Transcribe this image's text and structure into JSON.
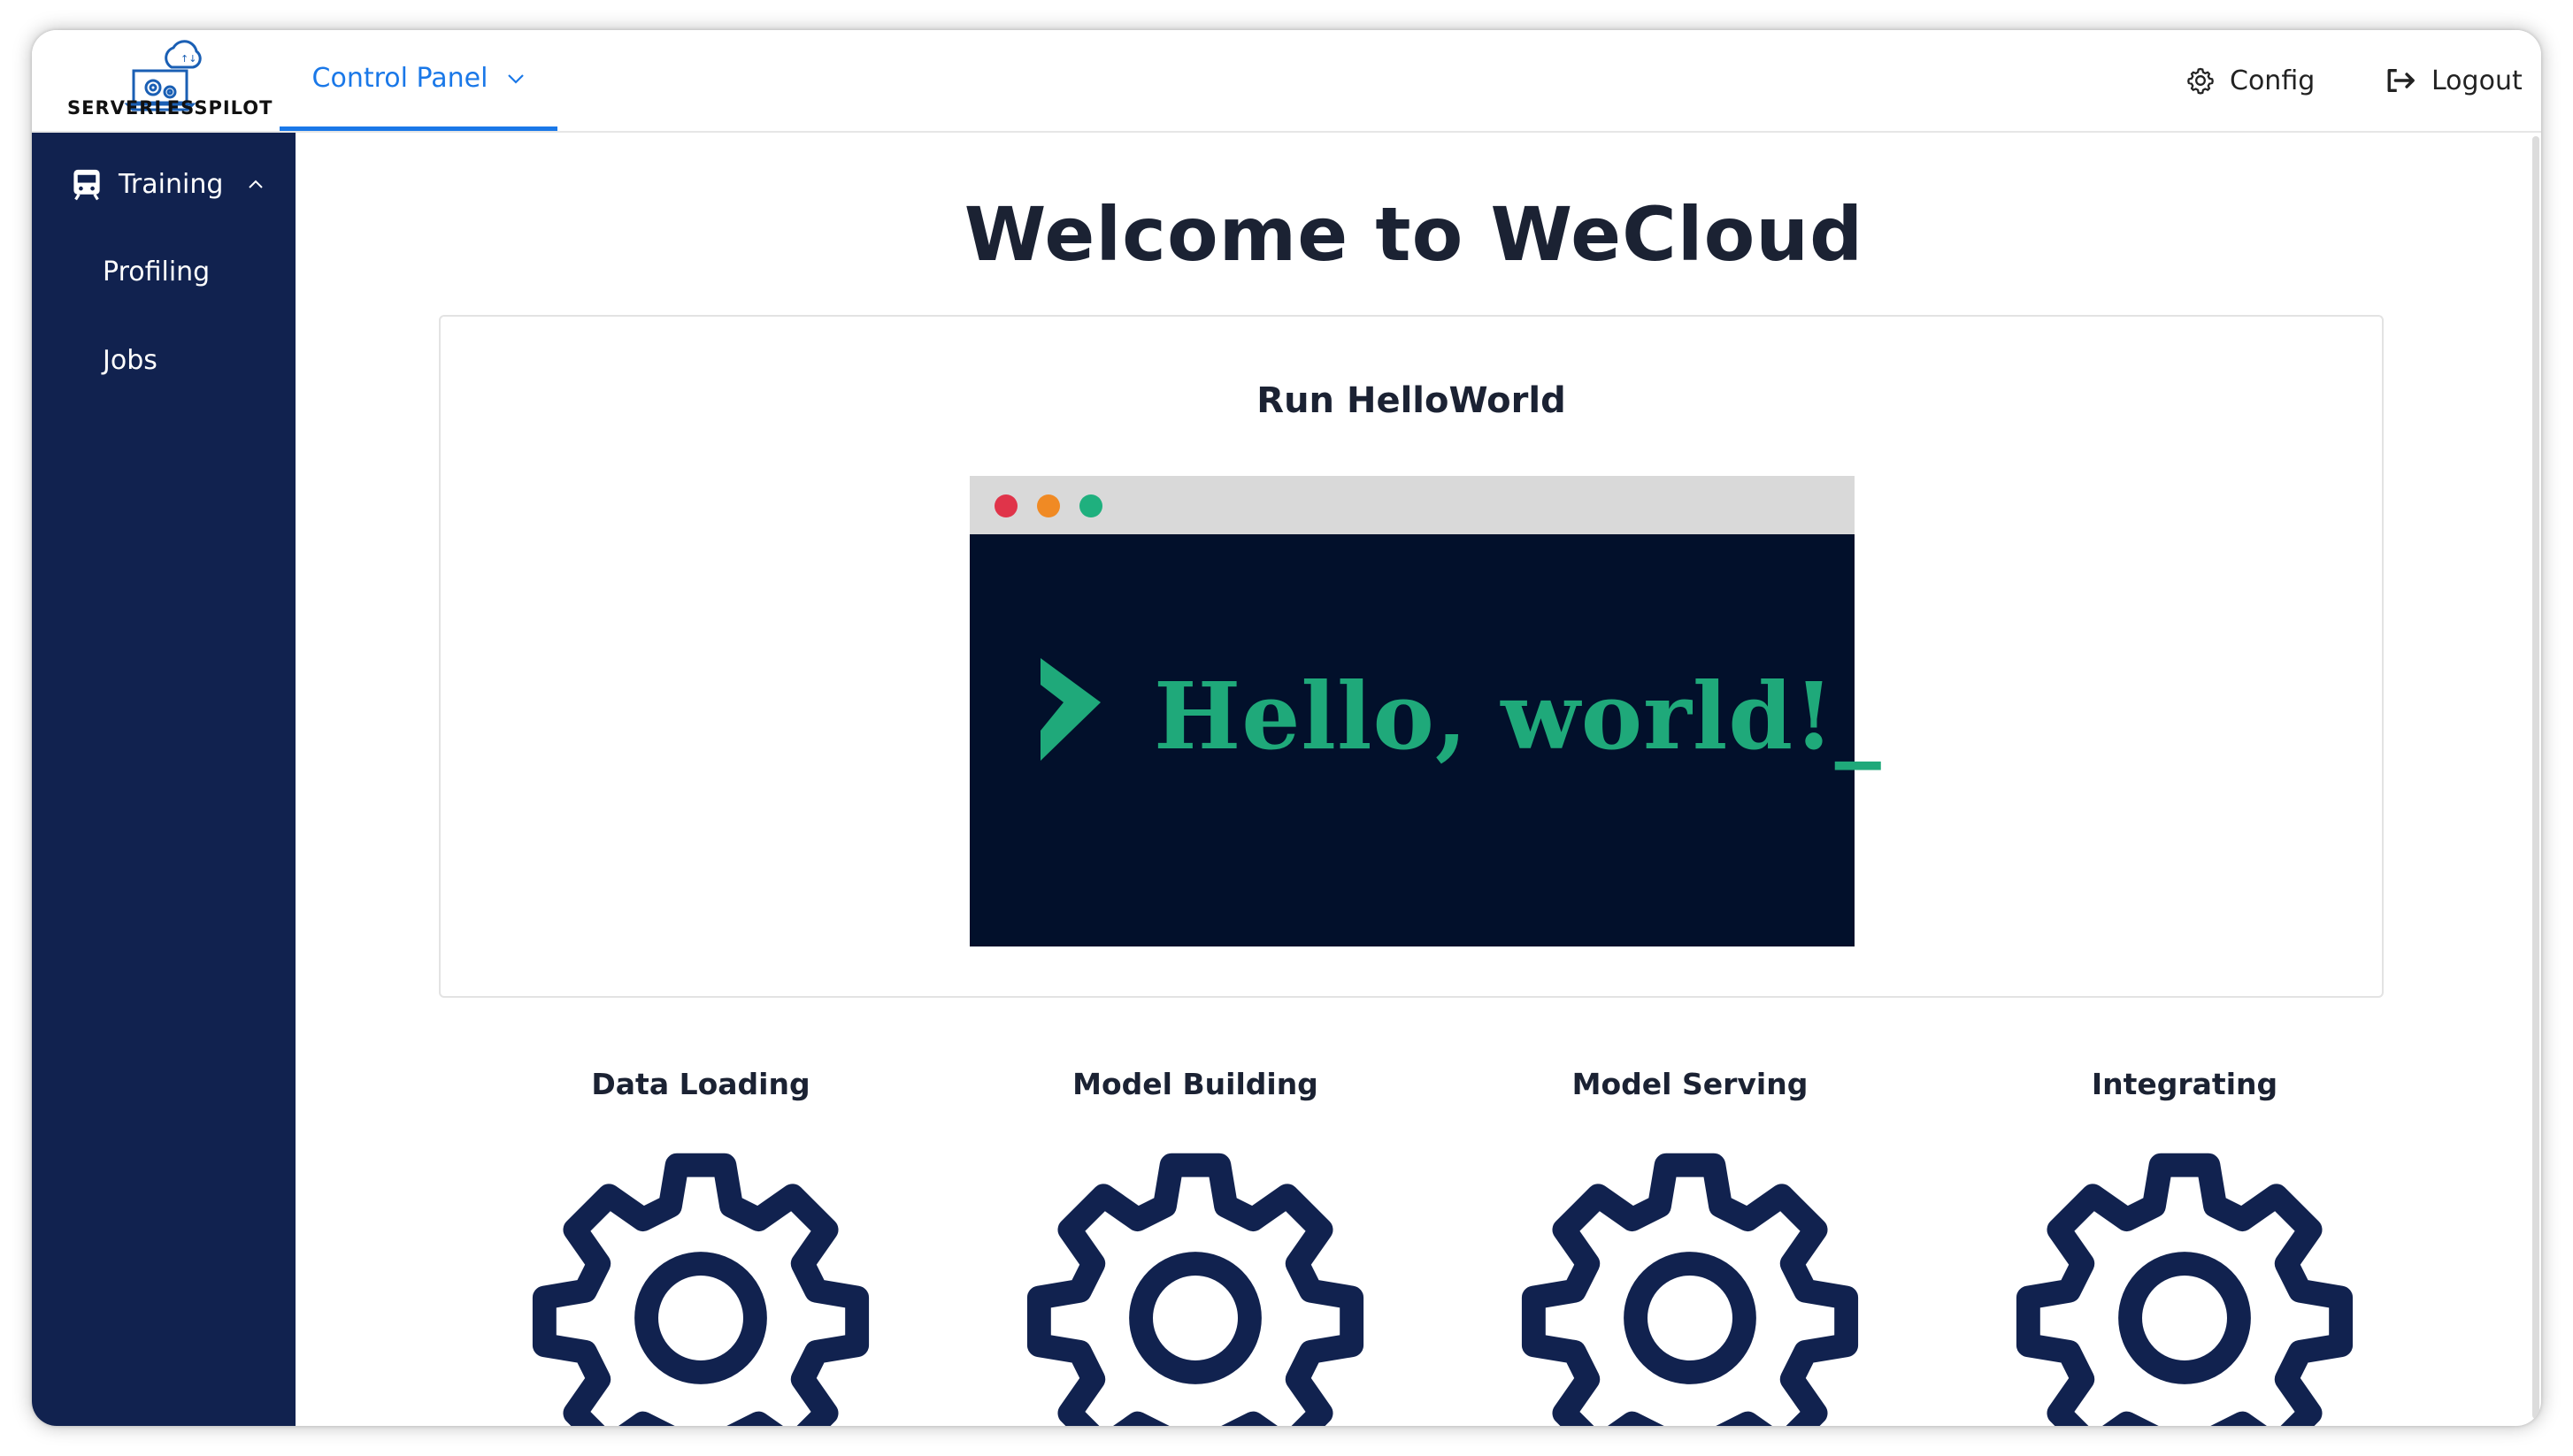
{
  "header": {
    "logo_text": "SERVERLESSPILOT",
    "nav_tab": "Control Panel",
    "config_label": "Config",
    "logout_label": "Logout"
  },
  "sidebar": {
    "section_label": "Training",
    "items": [
      {
        "label": "Profiling"
      },
      {
        "label": "Jobs"
      }
    ]
  },
  "main": {
    "title": "Welcome to WeCloud",
    "card": {
      "title": "Run HelloWorld",
      "terminal_text": "Hello, world!_"
    },
    "features": [
      {
        "label": "Data Loading"
      },
      {
        "label": "Model Building"
      },
      {
        "label": "Model Serving"
      },
      {
        "label": "Integrating"
      }
    ]
  },
  "colors": {
    "accent": "#1a78e8",
    "sidebar_bg": "#11224f",
    "gear": "#11224f",
    "terminal_bg": "#02102b",
    "terminal_text": "#1fa97a",
    "dot_red": "#e0344a",
    "dot_orange": "#f08a24",
    "dot_green": "#1fb07e"
  },
  "icons": [
    "cloud-gear-laptop-icon",
    "chevron-down-icon",
    "gear-icon",
    "logout-icon",
    "train-icon",
    "chevron-up-icon",
    "prompt-chevron-icon",
    "settings-gear-icon"
  ]
}
